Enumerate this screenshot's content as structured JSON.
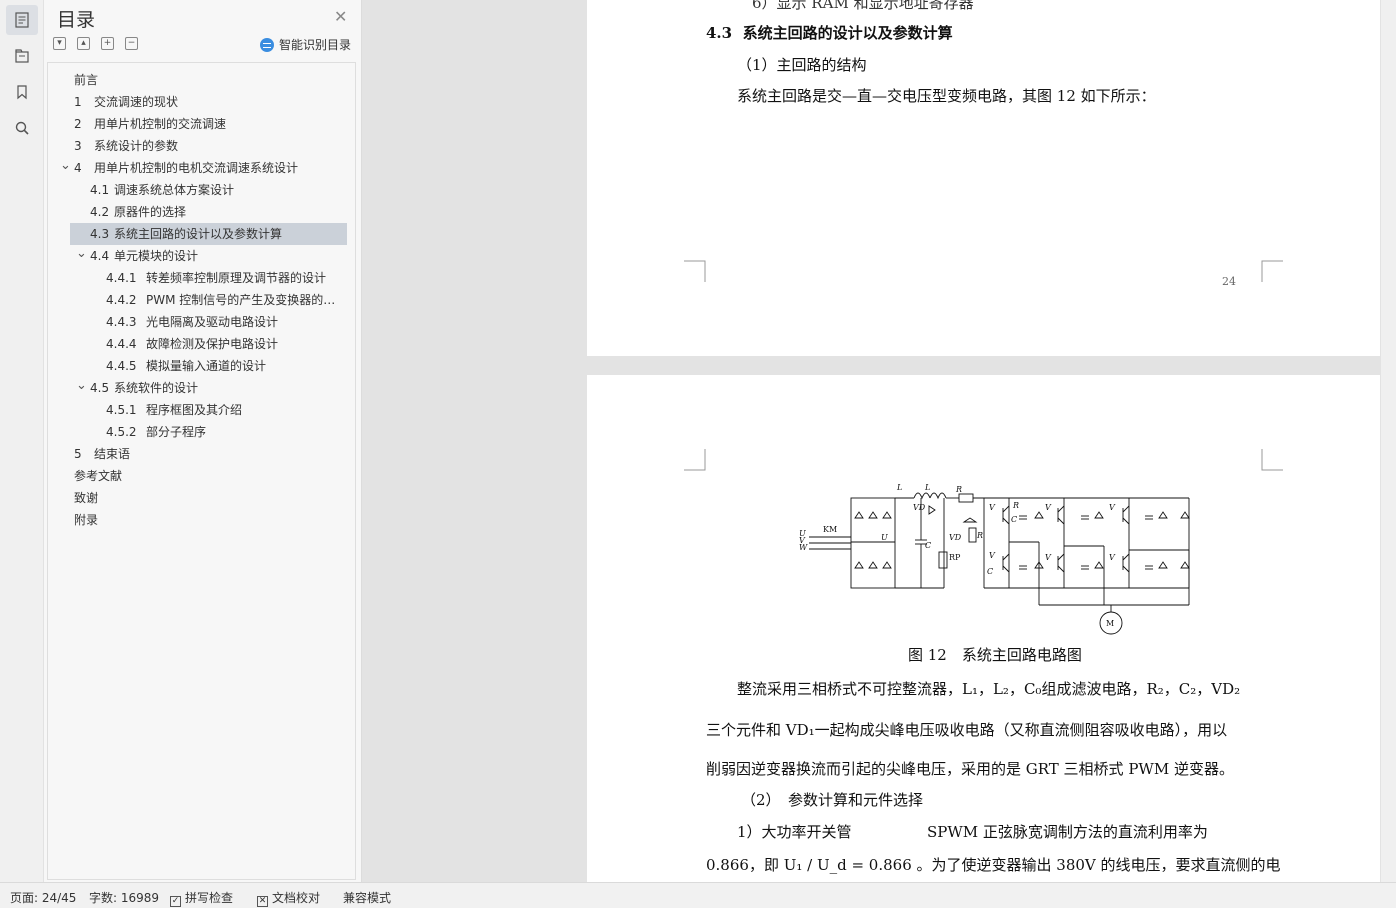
{
  "rail": {
    "icons": [
      "outline-icon",
      "nav-pane-icon",
      "bookmark-icon",
      "search-icon"
    ]
  },
  "toc": {
    "title": "目录",
    "smart_label": "智能识别目录",
    "items": [
      {
        "num": "",
        "text": "前言"
      },
      {
        "num": "1",
        "text": "交流调速的现状"
      },
      {
        "num": "2",
        "text": "用单片机控制的交流调速"
      },
      {
        "num": "3",
        "text": "系统设计的参数"
      },
      {
        "num": "4",
        "text": "用单片机控制的电机交流调速系统设计"
      },
      {
        "num": "4.1",
        "text": "调速系统总体方案设计"
      },
      {
        "num": "4.2",
        "text": "原器件的选择"
      },
      {
        "num": "4.3",
        "text": "系统主回路的设计以及参数计算"
      },
      {
        "num": "4.4",
        "text": "单元模块的设计"
      },
      {
        "num": "4.4.1",
        "text": "转差频率控制原理及调节器的设计"
      },
      {
        "num": "4.4.2",
        "text": "PWM 控制信号的产生及变换器的设计"
      },
      {
        "num": "4.4.3",
        "text": "光电隔离及驱动电路设计"
      },
      {
        "num": "4.4.4",
        "text": "故障检测及保护电路设计"
      },
      {
        "num": "4.4.5",
        "text": "模拟量输入通道的设计"
      },
      {
        "num": "4.5",
        "text": "系统软件的设计"
      },
      {
        "num": "4.5.1",
        "text": "程序框图及其介绍"
      },
      {
        "num": "4.5.2",
        "text": "部分子程序"
      },
      {
        "num": "5",
        "text": "结束语"
      },
      {
        "num": "",
        "text": "参考文献"
      },
      {
        "num": "",
        "text": "致谢"
      },
      {
        "num": "",
        "text": "附录"
      }
    ]
  },
  "page1": {
    "clipped_line": "6）显示 RAM 和显示地址寄存器",
    "heading_num": "4.3",
    "heading_text": "系统主回路的设计以及参数计算",
    "sub1": "（1）主回路的结构",
    "para1": "系统主回路是交—直—交电压型变频电路，其图 12 如下所示：",
    "page_number": "24"
  },
  "page2": {
    "figure_caption": "图 12　系统主回路电路图",
    "circuit_labels": {
      "L1": "L",
      "L2": "L",
      "Rs": "R",
      "VD1": "VD",
      "VD2": "VD",
      "R1": "R",
      "C1": "C",
      "R2": "R",
      "C2": "C",
      "RP1": "RP",
      "C0": "C",
      "Ud": "U",
      "V1": "V",
      "V3": "V",
      "V5": "V",
      "V4": "V",
      "V6": "V",
      "V2": "V",
      "KM": "KM",
      "U": "U",
      "V": "V",
      "W": "W",
      "M": "M"
    },
    "para2_line1": "整流采用三相桥式不可控整流器，L₁，L₂，C₀组成滤波电路，R₂，C₂，VD₂",
    "para2_line2": "三个元件和 VD₁一起构成尖峰电压吸收电路（又称直流侧阻容吸收电路），用以",
    "para2_line3": "削弱因逆变器换流而引起的尖峰电压，采用的是 GRT 三相桥式 PWM 逆变器。",
    "sub2": "（2）　参数计算和元件选择",
    "item1_label": "1）大功率开关管",
    "item1_text": "SPWM 正弦脉宽调制方法的直流利用率为",
    "last_line": "0.866，即 U₁ / U_d = 0.866 。为了使逆变器输出 380V 的线电压，要求直流侧的电"
  },
  "status": {
    "page": "页面: 24/45",
    "words": "字数: 16989",
    "spell": "拼写检查",
    "proof": "文档校对",
    "compat": "兼容模式"
  }
}
